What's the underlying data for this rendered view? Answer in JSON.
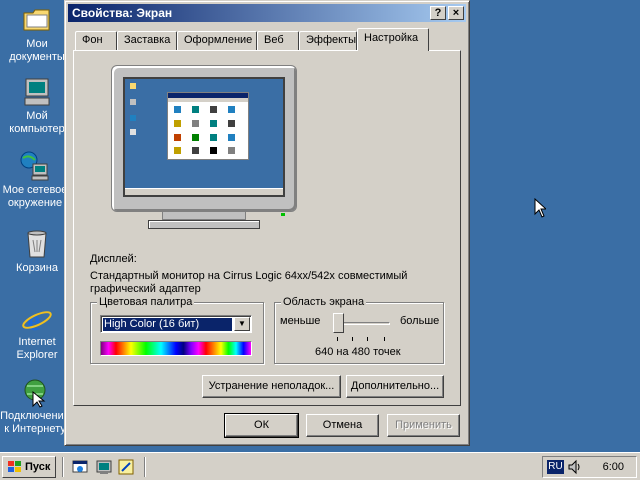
{
  "desktop": {
    "icons": [
      {
        "label": "Мои документы"
      },
      {
        "label": "Мой компьютер"
      },
      {
        "label": "Мое сетевое окружение"
      },
      {
        "label": "Корзина"
      },
      {
        "label": "Internet Explorer"
      },
      {
        "label": "Подключение к Интернету"
      }
    ]
  },
  "dialog": {
    "title": "Свойства: Экран",
    "help_button": "?",
    "close_button": "×",
    "tabs": [
      {
        "label": "Фон"
      },
      {
        "label": "Заставка"
      },
      {
        "label": "Оформление"
      },
      {
        "label": "Веб"
      },
      {
        "label": "Эффекты"
      },
      {
        "label": "Настройка",
        "active": true
      }
    ],
    "display_label": "Дисплей:",
    "display_value_line1": "Стандартный монитор на Cirrus Logic 64xx/542x совместимый",
    "display_value_line2": "графический адаптер",
    "color_palette": {
      "legend": "Цветовая палитра",
      "selected": "High Color (16 бит)"
    },
    "screen_area": {
      "legend": "Область экрана",
      "less_label": "меньше",
      "more_label": "больше",
      "value_text": "640 на 480 точек",
      "slider_level": 0.0
    },
    "troubleshoot_button": "Устранение неполадок...",
    "advanced_button": "Дополнительно...",
    "ok_button": "ОК",
    "cancel_button": "Отмена",
    "apply_button": "Применить"
  },
  "taskbar": {
    "start_label": "Пуск",
    "language": "RU",
    "clock": "6:00"
  },
  "colors": {
    "desktop": "#3a6ea5",
    "face": "#d4d0c8",
    "title_active": "#0a246a"
  }
}
